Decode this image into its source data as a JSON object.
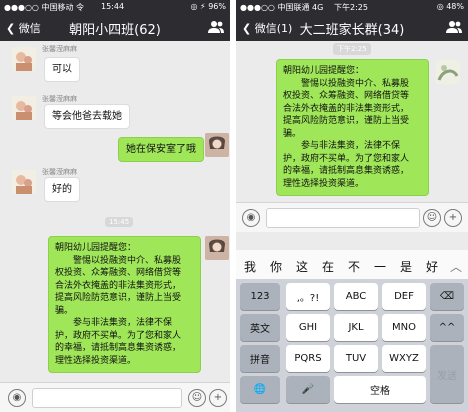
{
  "left": {
    "status": {
      "carrier": "●●●○○ 中国移动 令",
      "time": "15:44",
      "battery": "◎ ⚡ 96%"
    },
    "nav": {
      "back_label": "微信",
      "title": "朝阳小四班(62)"
    },
    "messages": [
      {
        "sender": "张馨滢麻麻",
        "text": "可以"
      },
      {
        "sender": "张馨滢麻麻",
        "text": "等会他爸去载她"
      },
      {
        "text": "她在保安室了哦"
      },
      {
        "sender": "张馨滢麻麻",
        "text": "好的"
      }
    ],
    "timestamp": "15:45",
    "notice_lines": [
      "朝阳幼儿园提醒您：",
      "　　警惕以投融资中介、私募股",
      "权投资、众筹融资、网络借贷等",
      "合法外衣掩盖的非法集资形式，",
      "提高风险防范意识，谨防上当受",
      "骗。",
      "　　参与非法集资，法律不保",
      "护，政府不买单。为了您和家人",
      "的幸福，请抵制高息集资诱惑，",
      "理性选择投资渠道。"
    ]
  },
  "right": {
    "status": {
      "carrier": "●●●○○ 中国联通 4G",
      "time": "下午2:25",
      "battery": "◎ 48%"
    },
    "nav": {
      "back_label": "微信(1)",
      "title": "大二班家长群(34)"
    },
    "timestamp": "下午2:25",
    "notice_lines": [
      "朝阳幼儿园提醒您：",
      "　　警惕以投融资中介、私募股",
      "权投资、众筹融资、网络借贷等",
      "合法外衣掩盖的非法集资形式，",
      "提高风险防范意识，谨防上当受",
      "骗。",
      "　　参与非法集资，法律不保",
      "护，政府不买单。为了您和家人",
      "的幸福，请抵制高息集资诱惑，",
      "理性选择投资渠道。"
    ],
    "candidates": [
      "我",
      "你",
      "这",
      "在",
      "不",
      "一",
      "是",
      "好"
    ],
    "keyboard": {
      "row1": [
        "123",
        ",。?!",
        "ABC",
        "DEF",
        "⌫"
      ],
      "row2": [
        "英文",
        "GHI",
        "JKL",
        "MNO",
        "^^"
      ],
      "row3": [
        "拼音",
        "PQRS",
        "TUV",
        "WXYZ"
      ],
      "row4": [
        "🌐",
        "🎤",
        "空格"
      ],
      "send": "发送"
    }
  },
  "icons": {
    "people": "people-icon",
    "voice": "voice-icon",
    "emoji": "emoji-icon",
    "plus": "plus-icon"
  },
  "colors": {
    "navbar": "#2c2c31",
    "green_bubble": "#9fe659",
    "chat_bg": "#ebebeb"
  }
}
